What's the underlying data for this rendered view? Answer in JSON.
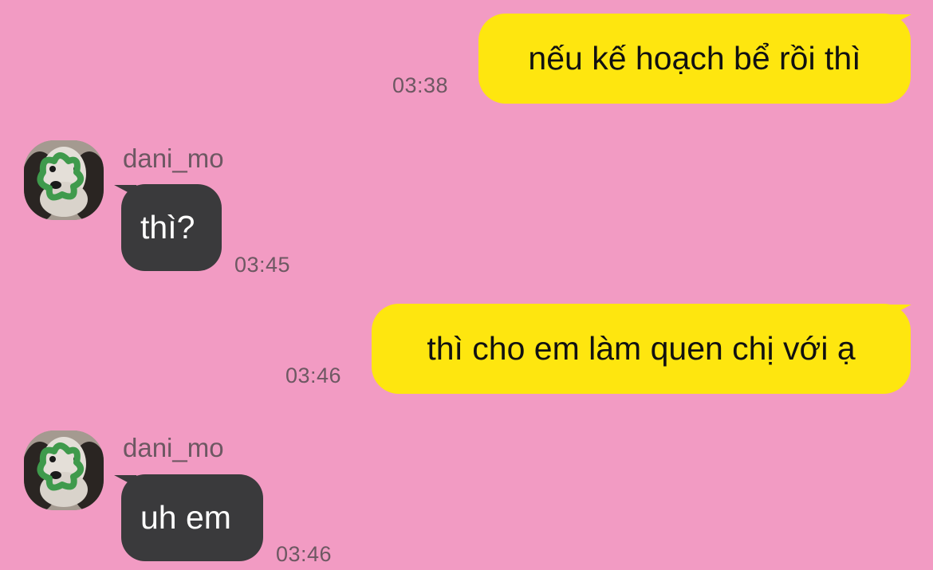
{
  "chat": {
    "messages": [
      {
        "sender": "me",
        "text": "nếu kế hoạch bể rồi thì",
        "time": "03:38"
      },
      {
        "sender": "dani_mo",
        "name": "dani_mo",
        "text": "thì?",
        "time": "03:45"
      },
      {
        "sender": "me",
        "text": "thì cho em làm quen chị với ạ",
        "time": "03:46"
      },
      {
        "sender": "dani_mo",
        "name": "dani_mo",
        "text": "uh em",
        "time": "03:46"
      }
    ],
    "avatar_icon": "dog-with-green-flower-ring-avatar"
  },
  "colors": {
    "background": "#f29bc3",
    "outgoing_bubble": "#fee60f",
    "incoming_bubble": "#3a3a3c",
    "meta_text": "#6d5862"
  }
}
